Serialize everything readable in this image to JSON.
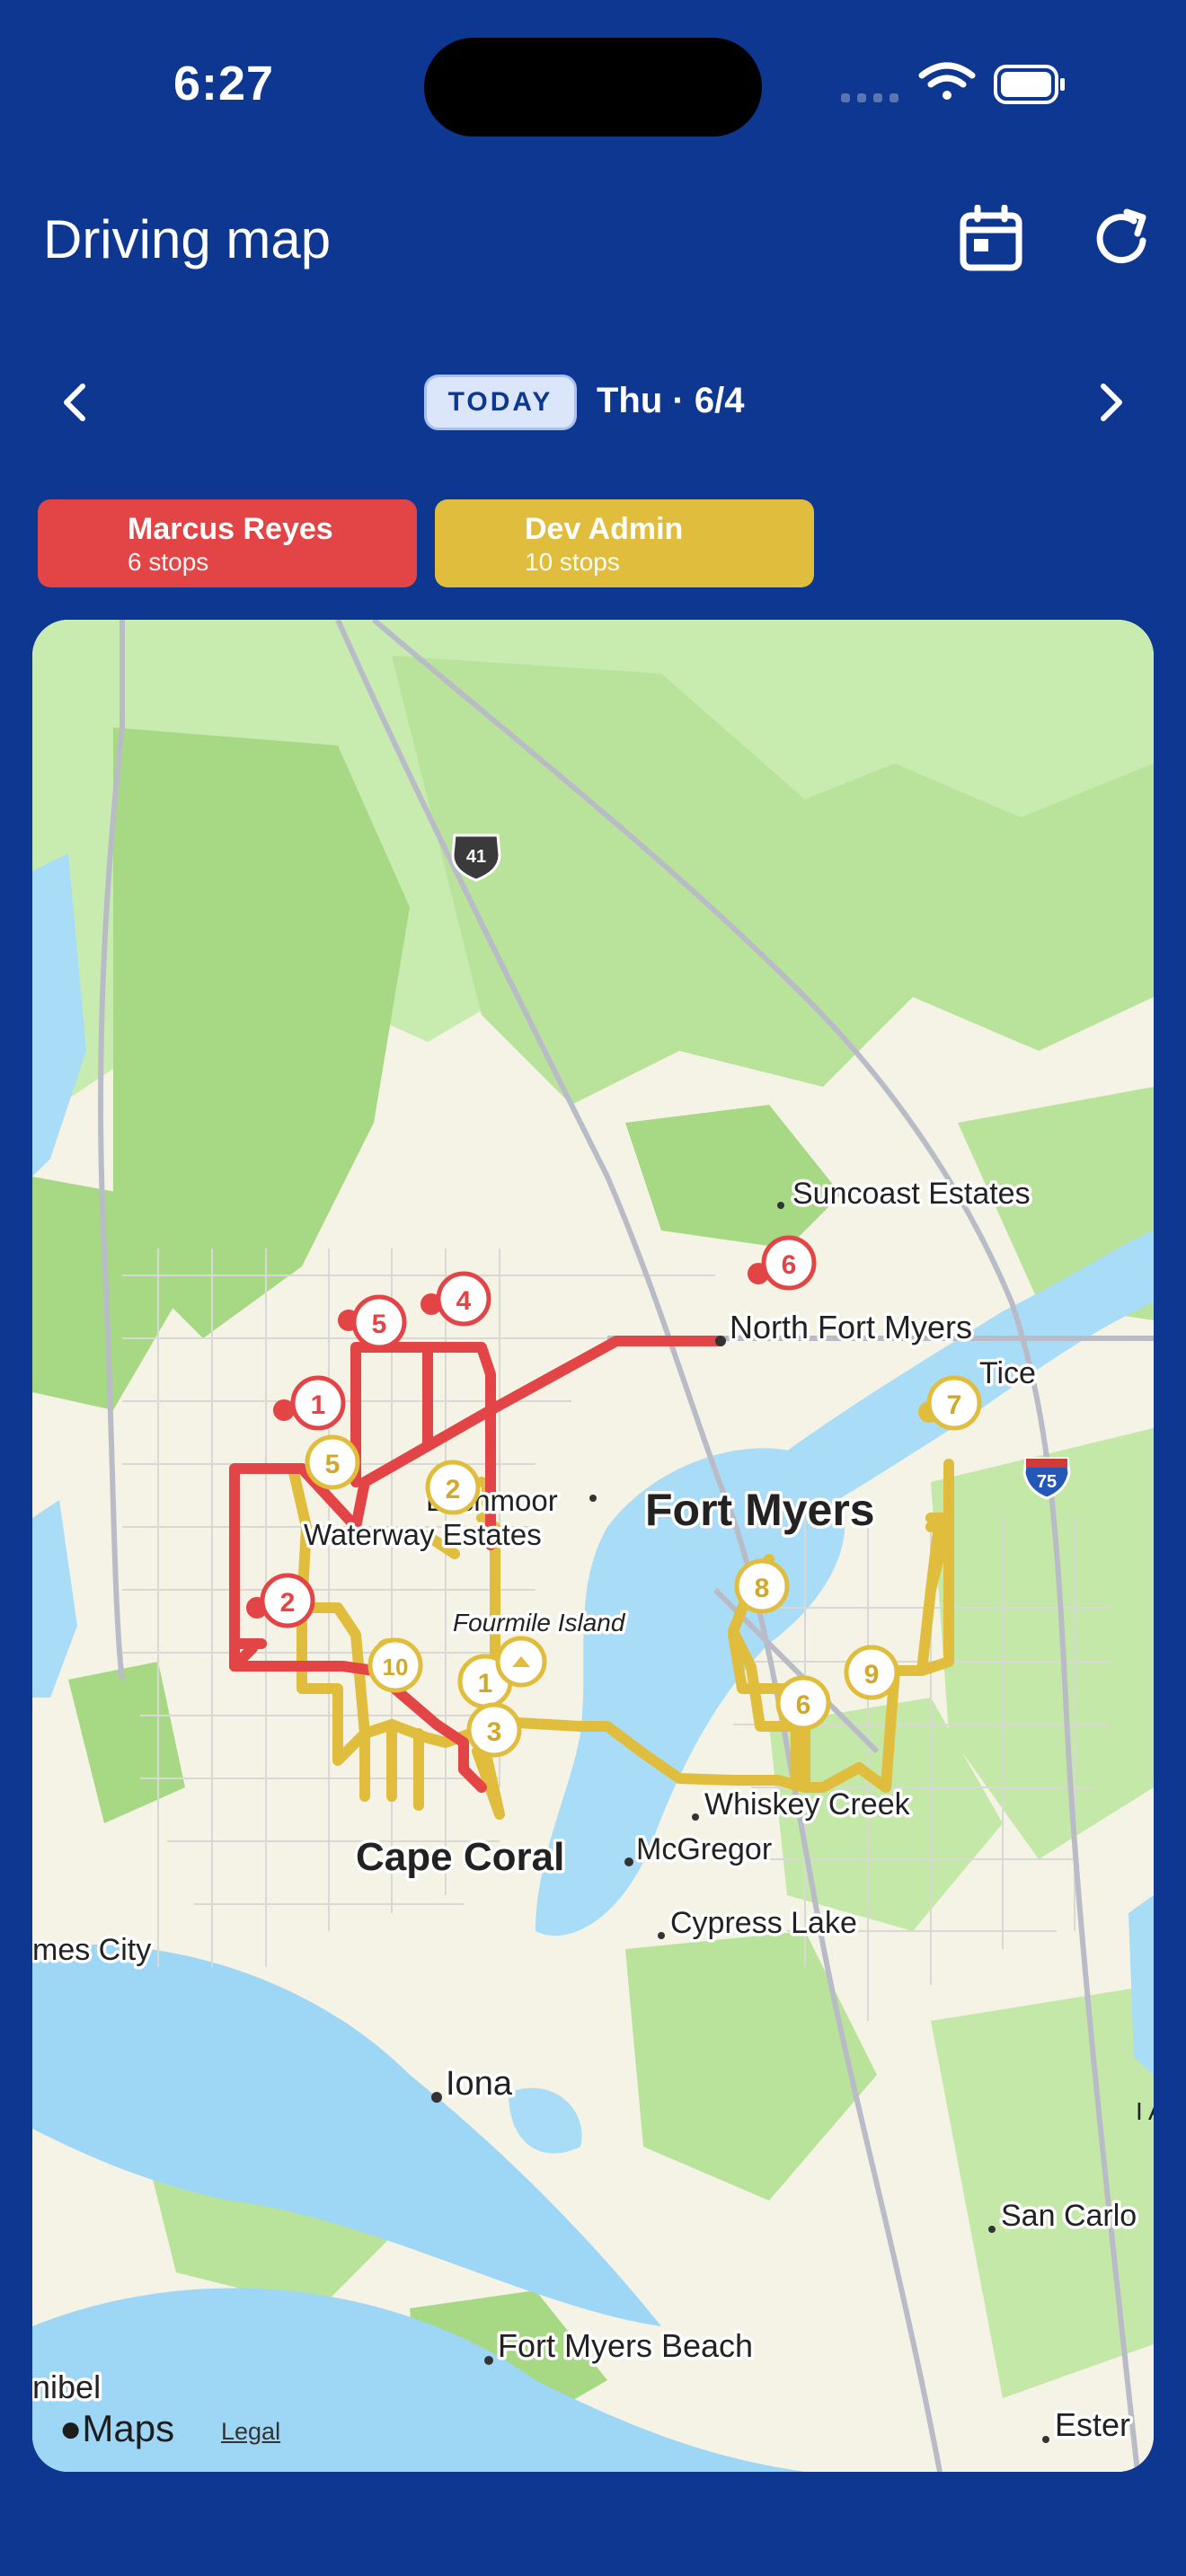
{
  "status_bar": {
    "time": "6:27"
  },
  "header": {
    "title": "Driving map",
    "calendar_icon": "calendar-icon",
    "refresh_icon": "refresh-icon"
  },
  "date_nav": {
    "today_label": "TODAY",
    "date_label": "Thu · 6/4",
    "prev_icon": "chevron-left-icon",
    "next_icon": "chevron-right-icon"
  },
  "drivers": [
    {
      "name": "Marcus Reyes",
      "stops_label": "6 stops",
      "color": "#e34446"
    },
    {
      "name": "Dev Admin",
      "stops_label": "10 stops",
      "color": "#e1bd3e"
    }
  ],
  "map": {
    "route_shield": "41",
    "interstate_shield": "75",
    "places": {
      "suncoast_estates": "Suncoast Estates",
      "north_fort_myers": "North Fort Myers",
      "tice": "Tice",
      "fort_myers": "Fort Myers",
      "lochmoor": "Lochmoor",
      "waterway_estates": "Waterway Estates",
      "fourmile_island": "Fourmile Island",
      "whiskey_creek": "Whiskey Creek",
      "mcgregor": "McGregor",
      "cape_coral": "Cape Coral",
      "cypress_lake": "Cypress Lake",
      "james_city": "mes City",
      "iona": "Iona",
      "san_carlos": "San Carlo",
      "fort_myers_beach": "Fort Myers Beach",
      "sanibel": "nibel",
      "estero": "Ester",
      "airport": "I A"
    },
    "red_stops": [
      "1",
      "2",
      "4",
      "5",
      "6"
    ],
    "yellow_stops": [
      "1",
      "2",
      "3",
      "5",
      "6",
      "7",
      "8",
      "9",
      "10"
    ],
    "attribution": {
      "logo": "Maps",
      "legal": "Legal"
    }
  }
}
